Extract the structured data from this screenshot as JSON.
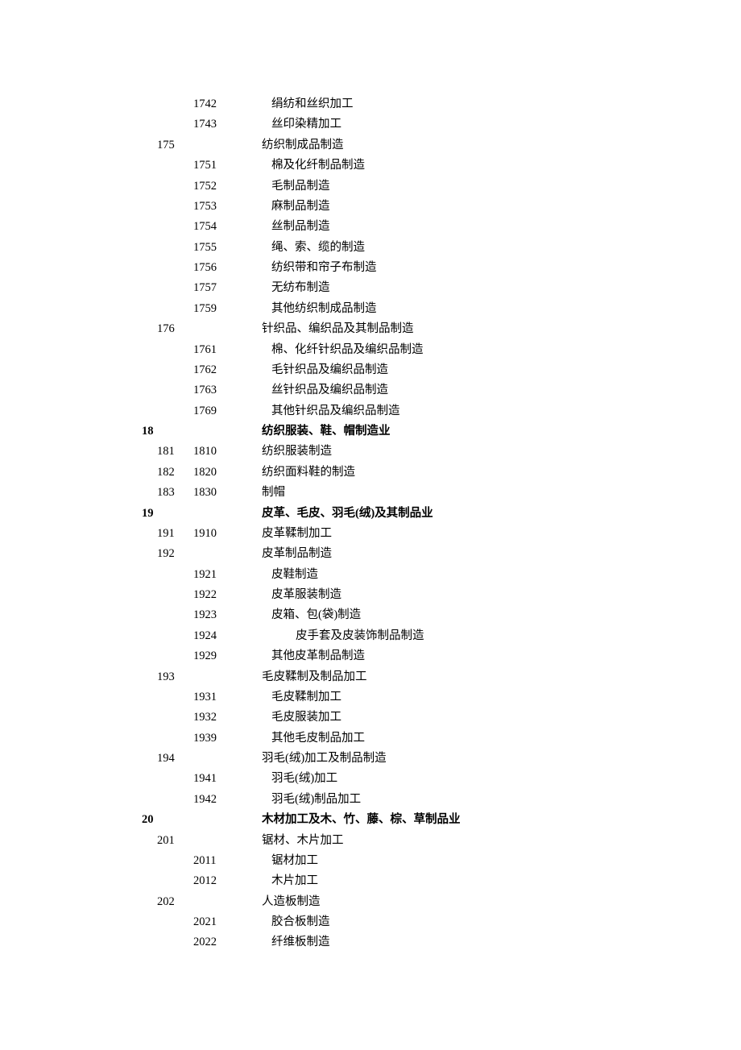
{
  "rows": [
    {
      "c1": "",
      "c2": "",
      "c3": "1742",
      "c4": "绢纺和丝织加工",
      "indent": 1,
      "bold": false
    },
    {
      "c1": "",
      "c2": "",
      "c3": "1743",
      "c4": "丝印染精加工",
      "indent": 1,
      "bold": false
    },
    {
      "c1": "",
      "c2": "175",
      "c3": "",
      "c4": "纺织制成品制造",
      "indent": 0,
      "bold": false
    },
    {
      "c1": "",
      "c2": "",
      "c3": "1751",
      "c4": "棉及化纤制品制造",
      "indent": 1,
      "bold": false
    },
    {
      "c1": "",
      "c2": "",
      "c3": "1752",
      "c4": "毛制品制造",
      "indent": 1,
      "bold": false
    },
    {
      "c1": "",
      "c2": "",
      "c3": "1753",
      "c4": "麻制品制造",
      "indent": 1,
      "bold": false
    },
    {
      "c1": "",
      "c2": "",
      "c3": "1754",
      "c4": "丝制品制造",
      "indent": 1,
      "bold": false
    },
    {
      "c1": "",
      "c2": "",
      "c3": "1755",
      "c4": "绳、索、缆的制造",
      "indent": 1,
      "bold": false
    },
    {
      "c1": "",
      "c2": "",
      "c3": "1756",
      "c4": "纺织带和帘子布制造",
      "indent": 1,
      "bold": false
    },
    {
      "c1": "",
      "c2": "",
      "c3": "1757",
      "c4": "无纺布制造",
      "indent": 1,
      "bold": false
    },
    {
      "c1": "",
      "c2": "",
      "c3": "1759",
      "c4": "其他纺织制成品制造",
      "indent": 1,
      "bold": false
    },
    {
      "c1": "",
      "c2": "176",
      "c3": "",
      "c4": "针织品、编织品及其制品制造",
      "indent": 0,
      "bold": false
    },
    {
      "c1": "",
      "c2": "",
      "c3": "1761",
      "c4": "棉、化纤针织品及编织品制造",
      "indent": 1,
      "bold": false
    },
    {
      "c1": "",
      "c2": "",
      "c3": "1762",
      "c4": "毛针织品及编织品制造",
      "indent": 1,
      "bold": false
    },
    {
      "c1": "",
      "c2": "",
      "c3": "1763",
      "c4": "丝针织品及编织品制造",
      "indent": 1,
      "bold": false
    },
    {
      "c1": "",
      "c2": "",
      "c3": "1769",
      "c4": "其他针织品及编织品制造",
      "indent": 1,
      "bold": false
    },
    {
      "c1": "18",
      "c2": "",
      "c3": "",
      "c4": "纺织服装、鞋、帽制造业",
      "indent": 0,
      "bold": true
    },
    {
      "c1": "",
      "c2": "181",
      "c3": "1810",
      "c4": "纺织服装制造",
      "indent": 0,
      "bold": false
    },
    {
      "c1": "",
      "c2": "182",
      "c3": "1820",
      "c4": "纺织面料鞋的制造",
      "indent": 0,
      "bold": false
    },
    {
      "c1": "",
      "c2": "183",
      "c3": "1830",
      "c4": "制帽",
      "indent": 0,
      "bold": false
    },
    {
      "c1": "19",
      "c2": "",
      "c3": "",
      "c4": "皮革、毛皮、羽毛(绒)及其制品业",
      "indent": 0,
      "bold": true
    },
    {
      "c1": "",
      "c2": "191",
      "c3": "1910",
      "c4": "皮革鞣制加工",
      "indent": 0,
      "bold": false
    },
    {
      "c1": "",
      "c2": "192",
      "c3": "",
      "c4": "皮革制品制造",
      "indent": 0,
      "bold": false
    },
    {
      "c1": "",
      "c2": "",
      "c3": "1921",
      "c4": "皮鞋制造",
      "indent": 1,
      "bold": false
    },
    {
      "c1": "",
      "c2": "",
      "c3": "1922",
      "c4": "皮革服装制造",
      "indent": 1,
      "bold": false
    },
    {
      "c1": "",
      "c2": "",
      "c3": "1923",
      "c4": "皮箱、包(袋)制造",
      "indent": 1,
      "bold": false
    },
    {
      "c1": "",
      "c2": "",
      "c3": "1924",
      "c4": "皮手套及皮装饰制品制造",
      "indent": 2,
      "bold": false
    },
    {
      "c1": "",
      "c2": "",
      "c3": "1929",
      "c4": "其他皮革制品制造",
      "indent": 1,
      "bold": false
    },
    {
      "c1": "",
      "c2": "193",
      "c3": "",
      "c4": "毛皮鞣制及制品加工",
      "indent": 0,
      "bold": false
    },
    {
      "c1": "",
      "c2": "",
      "c3": "1931",
      "c4": "毛皮鞣制加工",
      "indent": 1,
      "bold": false
    },
    {
      "c1": "",
      "c2": "",
      "c3": "1932",
      "c4": "毛皮服装加工",
      "indent": 1,
      "bold": false
    },
    {
      "c1": "",
      "c2": "",
      "c3": "1939",
      "c4": "其他毛皮制品加工",
      "indent": 1,
      "bold": false
    },
    {
      "c1": "",
      "c2": "194",
      "c3": "",
      "c4": "羽毛(绒)加工及制品制造",
      "indent": 0,
      "bold": false
    },
    {
      "c1": "",
      "c2": "",
      "c3": "1941",
      "c4": "羽毛(绒)加工",
      "indent": 1,
      "bold": false
    },
    {
      "c1": "",
      "c2": "",
      "c3": "1942",
      "c4": "羽毛(绒)制品加工",
      "indent": 1,
      "bold": false
    },
    {
      "c1": "20",
      "c2": "",
      "c3": "",
      "c4": "木材加工及木、竹、藤、棕、草制品业",
      "indent": 0,
      "bold": true
    },
    {
      "c1": "",
      "c2": "201",
      "c3": "",
      "c4": "锯材、木片加工",
      "indent": 0,
      "bold": false
    },
    {
      "c1": "",
      "c2": "",
      "c3": "2011",
      "c4": "锯材加工",
      "indent": 1,
      "bold": false
    },
    {
      "c1": "",
      "c2": "",
      "c3": "2012",
      "c4": "木片加工",
      "indent": 1,
      "bold": false
    },
    {
      "c1": "",
      "c2": "202",
      "c3": "",
      "c4": "人造板制造",
      "indent": 0,
      "bold": false
    },
    {
      "c1": "",
      "c2": "",
      "c3": "2021",
      "c4": "胶合板制造",
      "indent": 1,
      "bold": false
    },
    {
      "c1": "",
      "c2": "",
      "c3": "2022",
      "c4": "纤维板制造",
      "indent": 1,
      "bold": false
    }
  ]
}
